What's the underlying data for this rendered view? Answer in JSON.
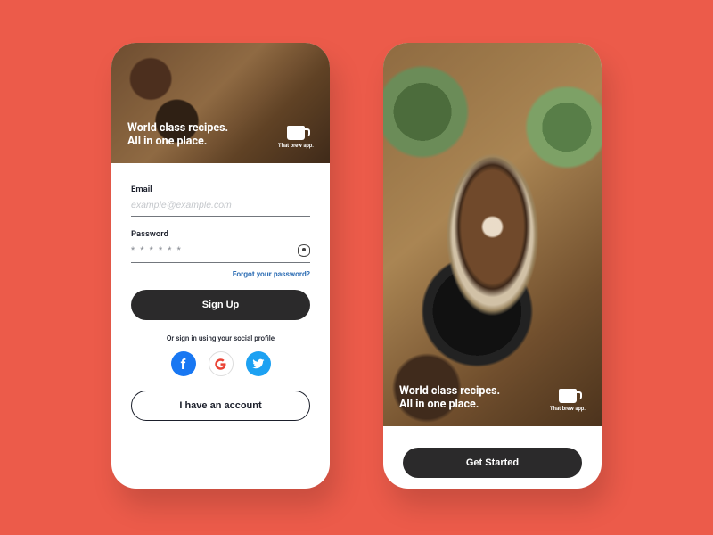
{
  "tagline_line1": "World class recipes.",
  "tagline_line2": "All in one place.",
  "brand_name": "That brew app.",
  "form": {
    "email_label": "Email",
    "email_placeholder": "example@example.com",
    "password_label": "Password",
    "password_mask": "* * * * * *",
    "forgot": "Forgot your password?",
    "signup_label": "Sign Up",
    "or_text": "Or sign in using your social profile",
    "have_account_label": "I have an account"
  },
  "onboard": {
    "get_started_label": "Get Started"
  },
  "socials": {
    "facebook": "f",
    "google": "G",
    "twitter": "twitter"
  }
}
